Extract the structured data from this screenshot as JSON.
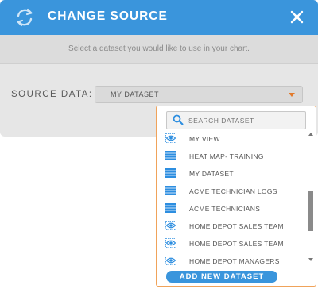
{
  "dialog": {
    "title": "CHANGE SOURCE",
    "subtitle": "Select a dataset you would like to use in your chart.",
    "source_label": "SOURCE DATA:",
    "selected_value": "MY DATASET"
  },
  "dropdown": {
    "search_placeholder": "SEARCH DATASET",
    "items": [
      {
        "label": "MY VIEW",
        "icon": "view-eye-icon"
      },
      {
        "label": "HEAT MAP- TRAINING",
        "icon": "dataset-grid-icon"
      },
      {
        "label": "MY DATASET",
        "icon": "dataset-grid-icon"
      },
      {
        "label": "ACME TECHNICIAN LOGS",
        "icon": "dataset-grid-icon"
      },
      {
        "label": "ACME TECHNICIANS",
        "icon": "dataset-grid-icon"
      },
      {
        "label": "HOME DEPOT SALES TEAM",
        "icon": "view-eye-icon"
      },
      {
        "label": "HOME DEPOT SALES TEAM",
        "icon": "view-eye-icon"
      },
      {
        "label": "HOME DEPOT MANAGERS",
        "icon": "view-eye-icon"
      }
    ],
    "add_button_label": "ADD NEW DATASET"
  },
  "colors": {
    "header": "#3a95dc",
    "accent": "#e27a2b",
    "icon_blue": "#2d8ee0"
  }
}
